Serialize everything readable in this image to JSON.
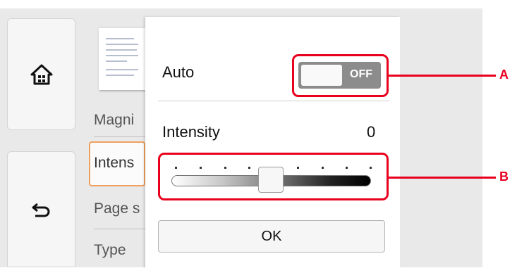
{
  "sidebar": {
    "home_icon": "home-icon",
    "back_icon": "back-arrow-icon"
  },
  "background_menu": {
    "items": [
      "Magnification",
      "Intensity",
      "Page size",
      "Type"
    ],
    "visible_text": [
      "Magni",
      "Intens",
      "Page s",
      "Type"
    ]
  },
  "dialog": {
    "auto_label": "Auto",
    "toggle_state": "OFF",
    "intensity_label": "Intensity",
    "intensity_value": "0",
    "slider_level": 0.5,
    "ok_label": "OK"
  },
  "callouts": {
    "a": "A",
    "b": "B"
  },
  "colors": {
    "accent_highlight": "#f0a060",
    "callout": "#e8001e",
    "toggle_off": "#8c8c8c"
  }
}
